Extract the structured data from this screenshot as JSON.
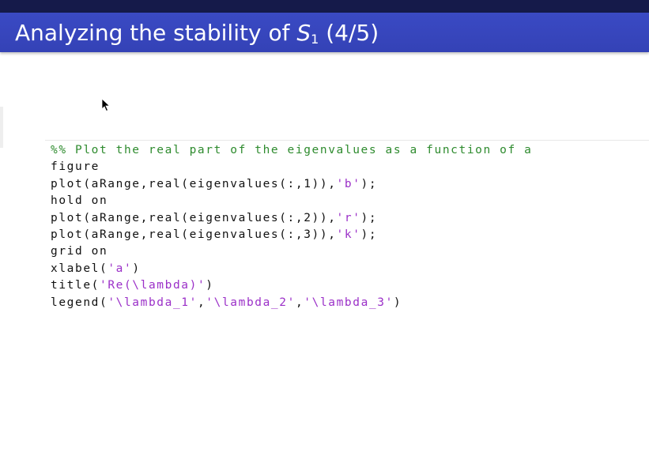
{
  "slide": {
    "title_prefix": "Analyzing the stability of ",
    "title_var": "S",
    "title_sub": "1",
    "title_suffix": " (4/5)"
  },
  "code": {
    "lines": [
      {
        "parts": [
          {
            "t": "%% Plot the real part of the eigenvalues as a function of a",
            "k": "comment"
          }
        ]
      },
      {
        "parts": [
          {
            "t": "figure",
            "k": "plain"
          }
        ]
      },
      {
        "parts": [
          {
            "t": "plot(aRange,real(eigenvalues(:,1)),",
            "k": "plain"
          },
          {
            "t": "'b'",
            "k": "str"
          },
          {
            "t": ");",
            "k": "plain"
          }
        ]
      },
      {
        "parts": [
          {
            "t": "hold on",
            "k": "plain"
          }
        ]
      },
      {
        "parts": [
          {
            "t": "plot(aRange,real(eigenvalues(:,2)),",
            "k": "plain"
          },
          {
            "t": "'r'",
            "k": "str"
          },
          {
            "t": ");",
            "k": "plain"
          }
        ]
      },
      {
        "parts": [
          {
            "t": "plot(aRange,real(eigenvalues(:,3)),",
            "k": "plain"
          },
          {
            "t": "'k'",
            "k": "str"
          },
          {
            "t": ");",
            "k": "plain"
          }
        ]
      },
      {
        "parts": [
          {
            "t": "grid on",
            "k": "plain"
          }
        ]
      },
      {
        "parts": [
          {
            "t": "xlabel(",
            "k": "plain"
          },
          {
            "t": "'a'",
            "k": "str"
          },
          {
            "t": ")",
            "k": "plain"
          }
        ]
      },
      {
        "parts": [
          {
            "t": "title(",
            "k": "plain"
          },
          {
            "t": "'Re(\\lambda)'",
            "k": "str"
          },
          {
            "t": ")",
            "k": "plain"
          }
        ]
      },
      {
        "parts": [
          {
            "t": "legend(",
            "k": "plain"
          },
          {
            "t": "'\\lambda_1'",
            "k": "str"
          },
          {
            "t": ",",
            "k": "plain"
          },
          {
            "t": "'\\lambda_2'",
            "k": "str"
          },
          {
            "t": ",",
            "k": "plain"
          },
          {
            "t": "'\\lambda_3'",
            "k": "str"
          },
          {
            "t": ")",
            "k": "plain"
          }
        ]
      }
    ]
  },
  "colors": {
    "title_bar": "#3a4ac4",
    "top_strip": "#151a4a",
    "comment": "#2e8b2e",
    "string": "#9b30c8"
  },
  "icons": {
    "pointer": "mouse-pointer-icon"
  }
}
